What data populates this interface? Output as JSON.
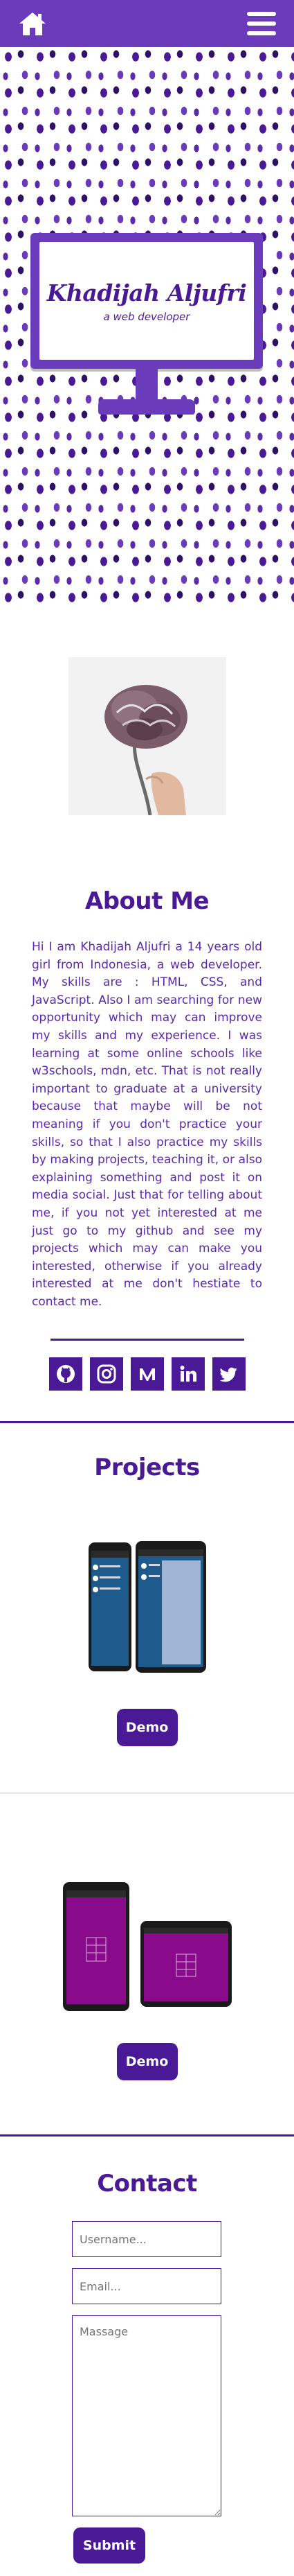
{
  "header": {
    "home_icon": "home-icon",
    "menu_icon": "hamburger-menu-icon"
  },
  "hero": {
    "name": "Khadijah Aljufri",
    "tagline": "a web developer"
  },
  "about": {
    "title": "About Me",
    "text": "Hi I am Khadijah Aljufri a 14 years old girl from Indonesia, a web developer. My skills are : HTML, CSS, and JavaScript. Also I am searching for new opportunity which may can improve my skills and my experience. I was learning at some online schools like w3schools, mdn, etc. That is not really important to graduate at a university because that maybe will be not meaning if you don't practice your skills, so that I also practice my skills by making projects, teaching it, or also explaining something and post it on media social. Just that for telling about me, if you not yet interested at me just go to my github and see my projects which may can make you interested, otherwise if you already interested at me don't hestiate to contact me."
  },
  "socials": [
    {
      "icon": "github-icon"
    },
    {
      "icon": "instagram-icon"
    },
    {
      "icon": "medium-icon"
    },
    {
      "icon": "linkedin-icon"
    },
    {
      "icon": "twitter-icon"
    }
  ],
  "projects": {
    "title": "Projects",
    "items": [
      {
        "demo_label": "Demo"
      },
      {
        "demo_label": "Demo"
      }
    ]
  },
  "contact": {
    "title": "Contact",
    "username_placeholder": "Username...",
    "email_placeholder": "Email...",
    "message_placeholder": "Massage",
    "submit_label": "Submit"
  },
  "colors": {
    "primary": "#4a1a96",
    "header": "#6a3cbc",
    "accent_magenta": "#8a0a8c",
    "accent_blue": "#1e5a8c"
  }
}
